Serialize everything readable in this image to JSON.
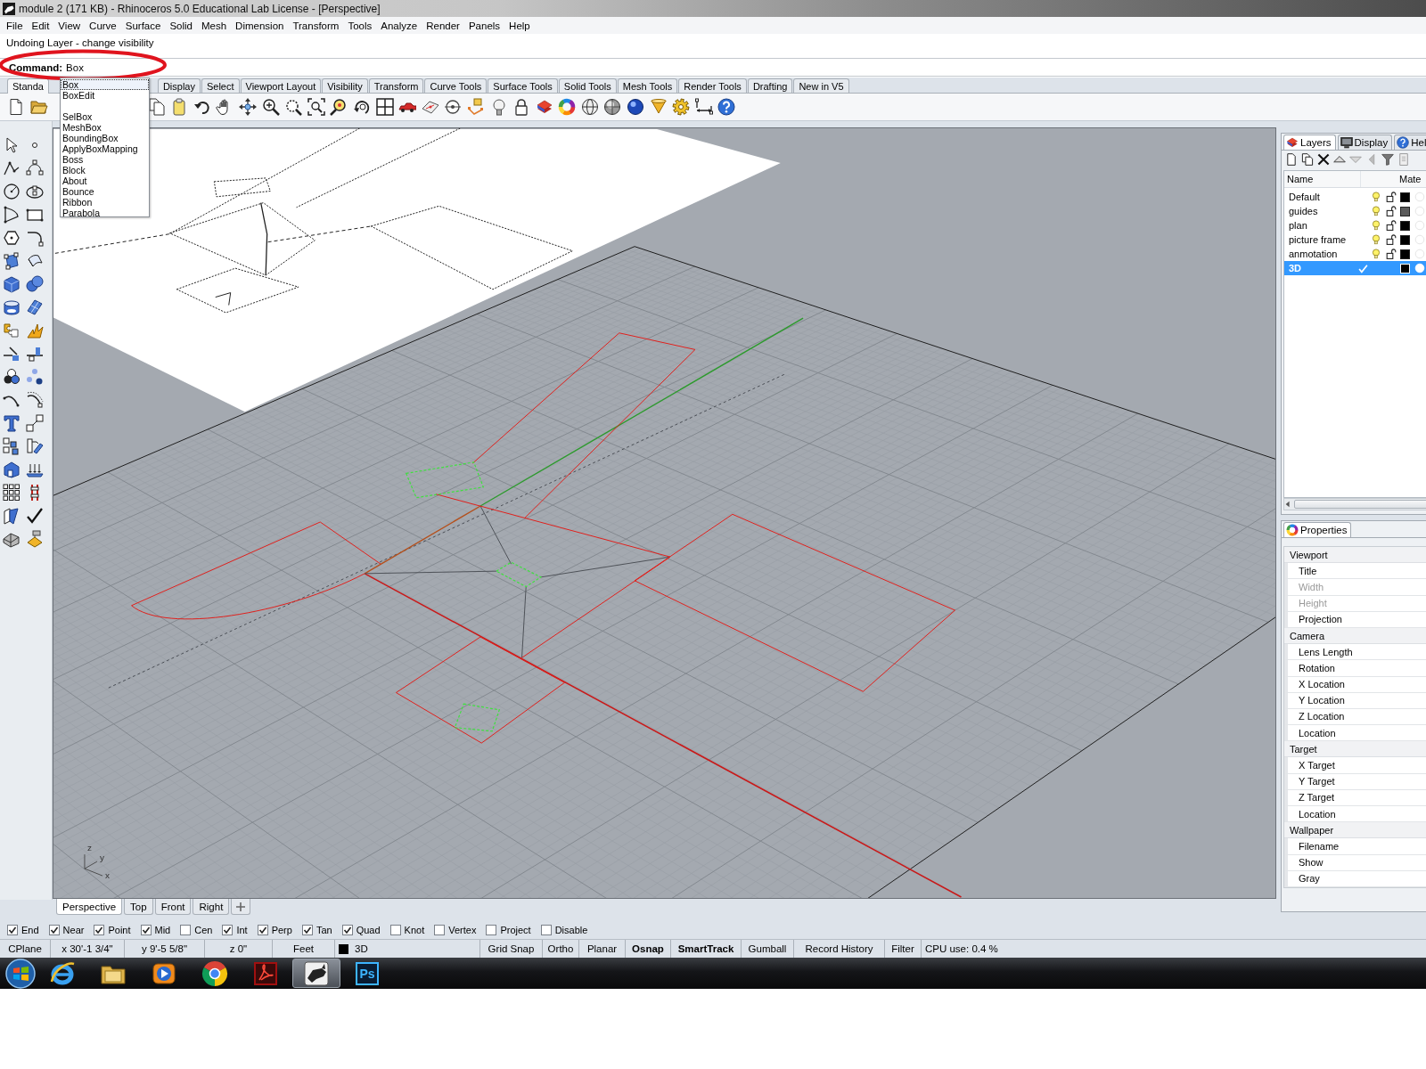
{
  "window": {
    "title": "module 2 (171 KB) - Rhinoceros 5.0 Educational Lab License - [Perspective]"
  },
  "menu": [
    "File",
    "Edit",
    "View",
    "Curve",
    "Surface",
    "Solid",
    "Mesh",
    "Dimension",
    "Transform",
    "Tools",
    "Analyze",
    "Render",
    "Panels",
    "Help"
  ],
  "command_history": [
    "Undoing Layer - change visibility"
  ],
  "command_line": {
    "prompt": "Command:",
    "value": "Box"
  },
  "autocomplete": [
    {
      "label": "Box",
      "selected": true
    },
    {
      "label": "BoxEdit",
      "selected": false
    },
    {
      "label": "SelBox",
      "selected": false
    },
    {
      "label": "MeshBox",
      "selected": false
    },
    {
      "label": "BoundingBox",
      "selected": false
    },
    {
      "label": "ApplyBoxMapping",
      "selected": false
    },
    {
      "label": "Boss",
      "selected": false
    },
    {
      "label": "Block",
      "selected": false
    },
    {
      "label": "About",
      "selected": false
    },
    {
      "label": "Bounce",
      "selected": false
    },
    {
      "label": "Ribbon",
      "selected": false
    },
    {
      "label": "Parabola",
      "selected": false
    }
  ],
  "toolbar_tabs": [
    {
      "label": "Standa",
      "selected": true
    },
    {
      "label": "Display",
      "selected": false
    },
    {
      "label": "Select",
      "selected": false
    },
    {
      "label": "Viewport Layout",
      "selected": false
    },
    {
      "label": "Visibility",
      "selected": false
    },
    {
      "label": "Transform",
      "selected": false
    },
    {
      "label": "Curve Tools",
      "selected": false
    },
    {
      "label": "Surface Tools",
      "selected": false
    },
    {
      "label": "Solid Tools",
      "selected": false
    },
    {
      "label": "Mesh Tools",
      "selected": false
    },
    {
      "label": "Render Tools",
      "selected": false
    },
    {
      "label": "Drafting",
      "selected": false
    },
    {
      "label": "New in V5",
      "selected": false
    }
  ],
  "viewport": {
    "axis_labels": [
      "z",
      "y",
      "x"
    ]
  },
  "viewport_tabs": [
    {
      "label": "Perspective",
      "selected": true
    },
    {
      "label": "Top",
      "selected": false
    },
    {
      "label": "Front",
      "selected": false
    },
    {
      "label": "Right",
      "selected": false
    }
  ],
  "layers_panel": {
    "tabs": [
      {
        "kind": "layers",
        "label": "Layers",
        "selected": true
      },
      {
        "kind": "display",
        "label": "Display",
        "selected": false
      },
      {
        "kind": "help",
        "label": "Hel",
        "selected": false
      }
    ],
    "columns": [
      "Name",
      "Mate"
    ],
    "layers": [
      {
        "name": "Default",
        "current": false,
        "selected": false,
        "color": "#000000"
      },
      {
        "name": "guides",
        "current": false,
        "selected": false,
        "color": "#5a5a5a"
      },
      {
        "name": "plan",
        "current": false,
        "selected": false,
        "color": "#000000"
      },
      {
        "name": "picture frame",
        "current": false,
        "selected": false,
        "color": "#000000"
      },
      {
        "name": "anmotation",
        "current": false,
        "selected": false,
        "color": "#000000"
      },
      {
        "name": "3D",
        "current": true,
        "selected": true,
        "color": "#000000"
      }
    ]
  },
  "properties_panel": {
    "tab": "Properties",
    "sections": [
      {
        "title": "Viewport",
        "rows": [
          {
            "label": "Title",
            "disabled": false
          },
          {
            "label": "Width",
            "disabled": true
          },
          {
            "label": "Height",
            "disabled": true
          },
          {
            "label": "Projection",
            "disabled": false
          }
        ]
      },
      {
        "title": "Camera",
        "rows": [
          {
            "label": "Lens Length",
            "disabled": false
          },
          {
            "label": "Rotation",
            "disabled": false
          },
          {
            "label": "X Location",
            "disabled": false
          },
          {
            "label": "Y Location",
            "disabled": false
          },
          {
            "label": "Z Location",
            "disabled": false
          },
          {
            "label": "Location",
            "disabled": false
          }
        ]
      },
      {
        "title": "Target",
        "rows": [
          {
            "label": "X Target",
            "disabled": false
          },
          {
            "label": "Y Target",
            "disabled": false
          },
          {
            "label": "Z Target",
            "disabled": false
          },
          {
            "label": "Location",
            "disabled": false
          }
        ]
      },
      {
        "title": "Wallpaper",
        "rows": [
          {
            "label": "Filename",
            "disabled": false
          },
          {
            "label": "Show",
            "disabled": false
          },
          {
            "label": "Gray",
            "disabled": false
          }
        ]
      }
    ]
  },
  "osnap": [
    {
      "label": "End",
      "checked": true
    },
    {
      "label": "Near",
      "checked": true
    },
    {
      "label": "Point",
      "checked": true
    },
    {
      "label": "Mid",
      "checked": true
    },
    {
      "label": "Cen",
      "checked": false
    },
    {
      "label": "Int",
      "checked": true
    },
    {
      "label": "Perp",
      "checked": true
    },
    {
      "label": "Tan",
      "checked": true
    },
    {
      "label": "Quad",
      "checked": true
    },
    {
      "label": "Knot",
      "checked": false
    },
    {
      "label": "Vertex",
      "checked": false
    },
    {
      "label": "Project",
      "checked": false
    },
    {
      "label": "Disable",
      "checked": false
    }
  ],
  "status_bar": {
    "cplane": "CPlane",
    "x": "x 30'-1 3/4\"",
    "y": "y 9'-5 5/8\"",
    "z": "z 0\"",
    "units": "Feet",
    "layer": {
      "name": "3D",
      "color": "#000000"
    },
    "toggles": [
      {
        "label": "Grid Snap",
        "on": false
      },
      {
        "label": "Ortho",
        "on": false
      },
      {
        "label": "Planar",
        "on": false
      },
      {
        "label": "Osnap",
        "on": true
      },
      {
        "label": "SmartTrack",
        "on": true
      },
      {
        "label": "Gumball",
        "on": false
      },
      {
        "label": "Record History",
        "on": false
      },
      {
        "label": "Filter",
        "on": false
      }
    ],
    "cpu": "CPU use: 0.4 %"
  },
  "taskbar": [
    {
      "kind": "browser",
      "selected": false
    },
    {
      "kind": "files",
      "selected": false
    },
    {
      "kind": "media",
      "selected": false
    },
    {
      "kind": "web",
      "selected": false
    },
    {
      "kind": "pdf",
      "selected": false
    },
    {
      "kind": "modeler",
      "selected": true
    },
    {
      "kind": "imaging",
      "label": "Ps",
      "selected": false
    }
  ]
}
